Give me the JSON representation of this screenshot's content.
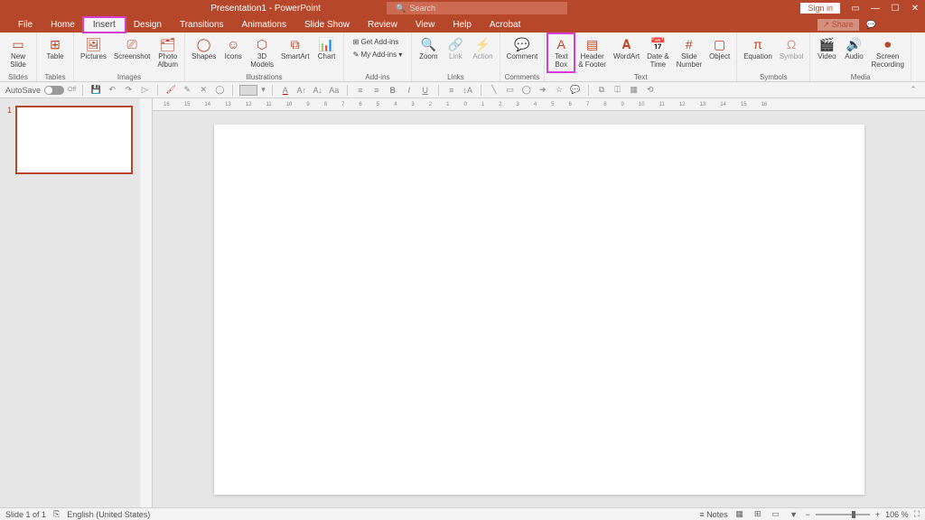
{
  "title": {
    "doc": "Presentation1",
    "app": "PowerPoint"
  },
  "search_placeholder": "Search",
  "signin": "Sign in",
  "tabs": [
    "File",
    "Home",
    "Insert",
    "Design",
    "Transitions",
    "Animations",
    "Slide Show",
    "Review",
    "View",
    "Help",
    "Acrobat"
  ],
  "active_tab": "Insert",
  "share": "Share",
  "comments": "Comments",
  "ribbon": {
    "slides": {
      "label": "Slides",
      "new_slide": "New\nSlide"
    },
    "tables": {
      "label": "Tables",
      "table": "Table"
    },
    "images": {
      "label": "Images",
      "pictures": "Pictures",
      "screenshot": "Screenshot",
      "photo_album": "Photo\nAlbum"
    },
    "illustrations": {
      "label": "Illustrations",
      "shapes": "Shapes",
      "icons": "Icons",
      "models": "3D\nModels",
      "smartart": "SmartArt",
      "chart": "Chart"
    },
    "addins": {
      "label": "Add-ins",
      "get": "Get Add-ins",
      "my": "My Add-ins"
    },
    "links": {
      "label": "Links",
      "zoom": "Zoom",
      "link": "Link",
      "action": "Action"
    },
    "comments_g": {
      "label": "Comments",
      "comment": "Comment"
    },
    "text": {
      "label": "Text",
      "textbox": "Text\nBox",
      "header": "Header\n& Footer",
      "wordart": "WordArt",
      "date": "Date &\nTime",
      "slidenum": "Slide\nNumber",
      "object": "Object"
    },
    "symbols": {
      "label": "Symbols",
      "equation": "Equation",
      "symbol": "Symbol"
    },
    "media": {
      "label": "Media",
      "video": "Video",
      "audio": "Audio",
      "screen": "Screen\nRecording"
    }
  },
  "autosave": {
    "label": "AutoSave",
    "state": "Off"
  },
  "thumb_num": "1",
  "ruler_marks": [
    "16",
    "15",
    "14",
    "13",
    "12",
    "11",
    "10",
    "9",
    "8",
    "7",
    "6",
    "5",
    "4",
    "3",
    "2",
    "1",
    "0",
    "1",
    "2",
    "3",
    "4",
    "5",
    "6",
    "7",
    "8",
    "9",
    "10",
    "11",
    "12",
    "13",
    "14",
    "15",
    "16"
  ],
  "status": {
    "slide": "Slide 1 of 1",
    "lang": "English (United States)",
    "notes": "Notes",
    "zoom": "106 %"
  }
}
